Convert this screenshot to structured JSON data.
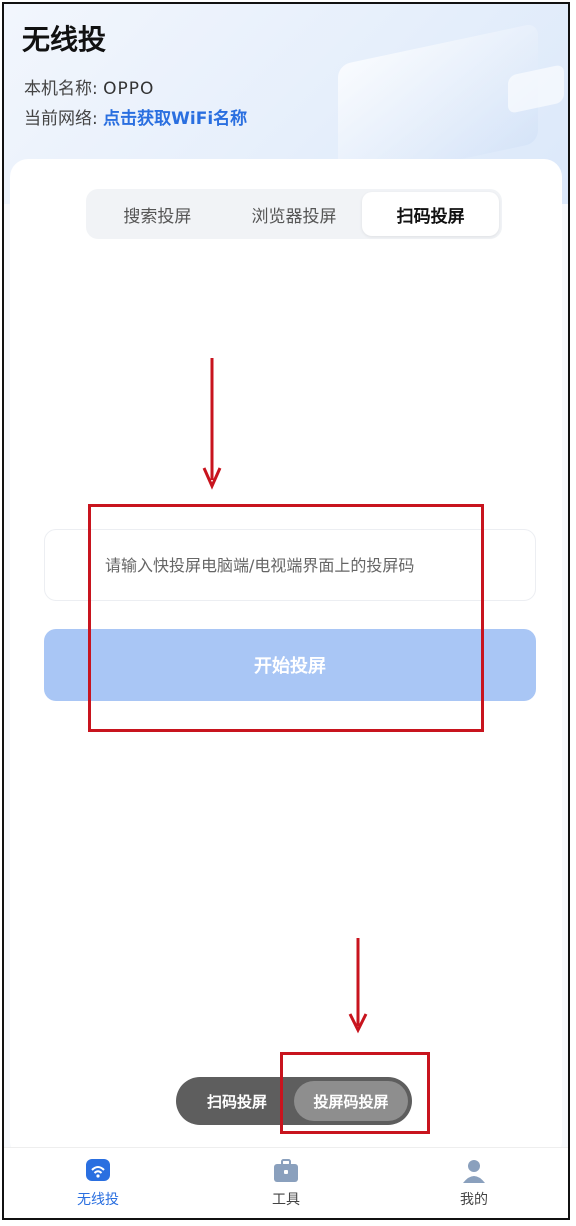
{
  "app": {
    "title": "无线投",
    "device_label": "本机名称:",
    "device_value": "OPPO",
    "network_label": "当前网络:",
    "network_link": "点击获取WiFi名称"
  },
  "tabs": [
    {
      "label": "搜索投屏",
      "active": false
    },
    {
      "label": "浏览器投屏",
      "active": false
    },
    {
      "label": "扫码投屏",
      "active": true
    }
  ],
  "code_entry": {
    "placeholder": "请输入快投屏电脑端/电视端界面上的投屏码",
    "value": ""
  },
  "start_button": {
    "label": "开始投屏"
  },
  "mode_toggle": [
    {
      "label": "扫码投屏",
      "active": false
    },
    {
      "label": "投屏码投屏",
      "active": true
    }
  ],
  "bottom_nav": [
    {
      "label": "无线投",
      "icon": "wifi-cast-icon",
      "active": true
    },
    {
      "label": "工具",
      "icon": "toolbox-icon",
      "active": false
    },
    {
      "label": "我的",
      "icon": "user-icon",
      "active": false
    }
  ],
  "colors": {
    "accent": "#2a6fe0",
    "button_disabled": "#a9c6f5",
    "annotation_red": "#c8141e",
    "toggle_bg": "#5e5e5e"
  }
}
